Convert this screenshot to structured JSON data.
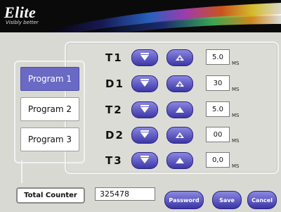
{
  "header": {
    "brand": "Elite",
    "tagline": "Visibly better"
  },
  "programs": [
    {
      "label": "Program 1",
      "active": true
    },
    {
      "label": "Program 2",
      "active": false
    },
    {
      "label": "Program 3",
      "active": false
    }
  ],
  "params": [
    {
      "label": "T1",
      "value": "5.0",
      "unit": "MS"
    },
    {
      "label": "D1",
      "value": "30",
      "unit": "MS"
    },
    {
      "label": "T2",
      "value": "5.0",
      "unit": "MS"
    },
    {
      "label": "D2",
      "value": "00",
      "unit": "MS"
    },
    {
      "label": "T3",
      "value": "0,0",
      "unit": "MS"
    }
  ],
  "counter": {
    "label": "Total Counter",
    "value": "325478"
  },
  "buttons": {
    "password": "Password",
    "save": "Save",
    "cancel": "Cancel"
  },
  "colors": {
    "accent": "#4a45b8",
    "active_program": "#6a6ac4"
  }
}
